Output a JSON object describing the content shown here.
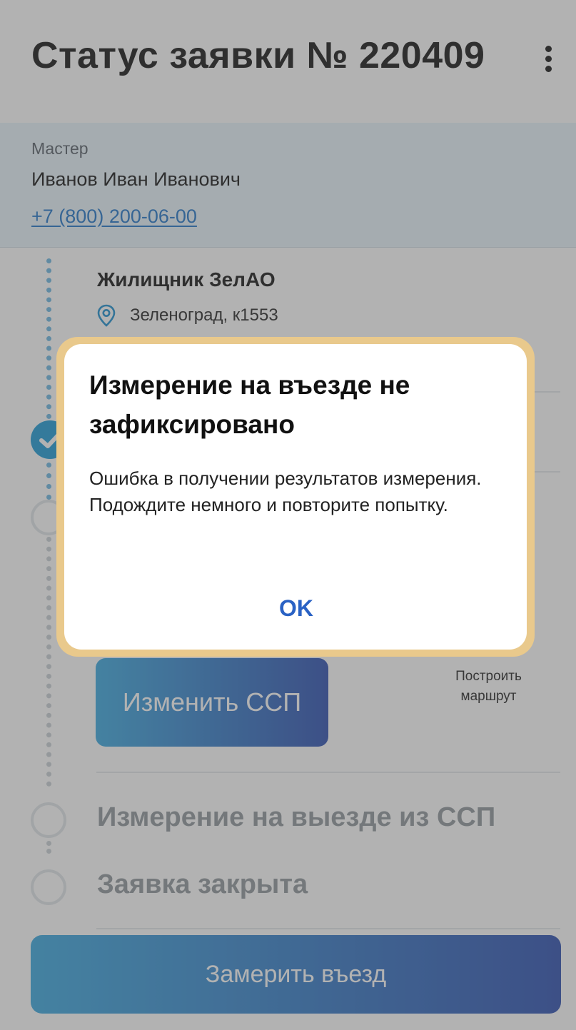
{
  "header": {
    "title": "Статус заявки № 220409",
    "menu_icon": "more-vertical-icon"
  },
  "master": {
    "label": "Мастер",
    "name": "Иванов Иван Иванович",
    "phone": "+7 (800) 200-06-00"
  },
  "organization": {
    "name": "Жилищник ЗелАО",
    "address": "Зеленоград, к1553",
    "address_icon": "location-pin-icon"
  },
  "actions": {
    "change_ssp": "Изменить ССП",
    "route": "Построить маршрут"
  },
  "steps": [
    {
      "label": "Измерение на выезде из ССП"
    },
    {
      "label": "Заявка закрыта"
    }
  ],
  "primary_button": "Замерить въезд",
  "dialog": {
    "title": "Измерение на въезде не зафиксировано",
    "message": "Ошибка в получении результатов измерения. Подождите немного и повторите попытку.",
    "ok": "OK"
  },
  "colors": {
    "accent_blue": "#1a9ad6",
    "gradient_start": "#38a8e0",
    "gradient_end": "#2a4db0",
    "dialog_border": "#e9c98c",
    "link": "#1e74c8"
  }
}
